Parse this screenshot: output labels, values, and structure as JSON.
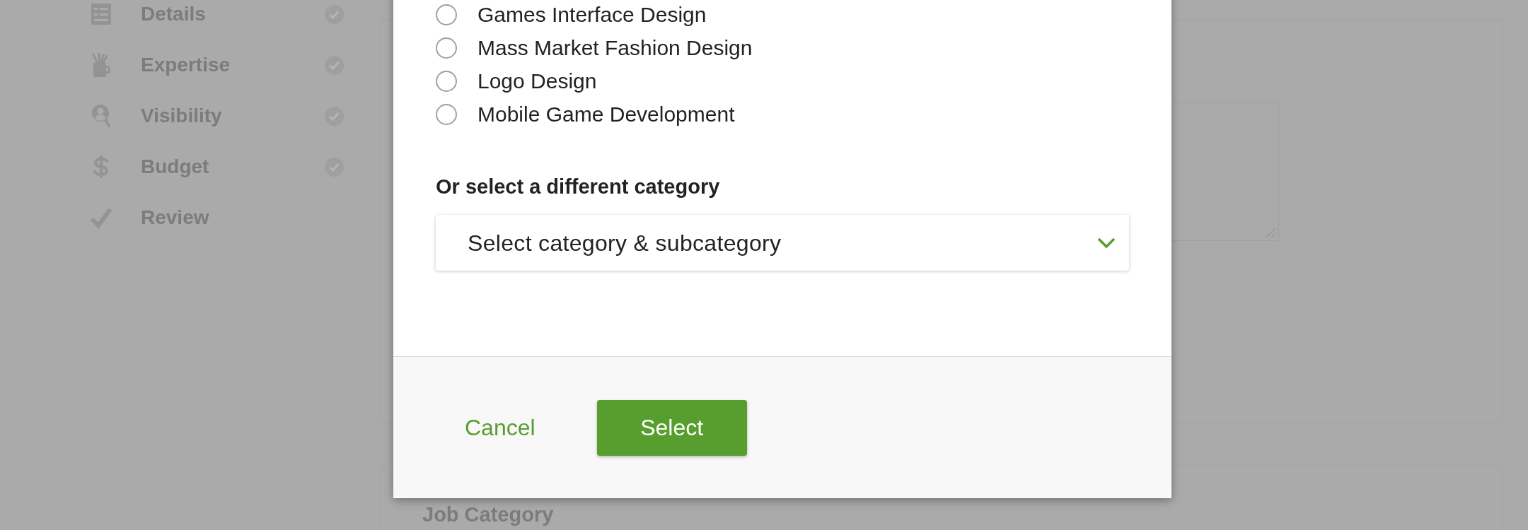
{
  "sidebar": {
    "items": [
      {
        "label": "Details",
        "completed": true
      },
      {
        "label": "Expertise",
        "completed": true
      },
      {
        "label": "Visibility",
        "completed": true
      },
      {
        "label": "Budget",
        "completed": true
      },
      {
        "label": "Review",
        "completed": false
      }
    ]
  },
  "job_category": {
    "title": "Job Category"
  },
  "dialog": {
    "options": [
      {
        "label": "Games Interface Design",
        "selected": false
      },
      {
        "label": "Mass Market Fashion Design",
        "selected": false
      },
      {
        "label": "Logo Design",
        "selected": false
      },
      {
        "label": "Mobile Game Development",
        "selected": false
      }
    ],
    "category_label": "Or select a different category",
    "category_select": {
      "placeholder": "Select category & subcategory"
    },
    "buttons": [
      {
        "label": "Cancel",
        "kind": "link"
      },
      {
        "label": "Select",
        "kind": "primary"
      }
    ]
  }
}
